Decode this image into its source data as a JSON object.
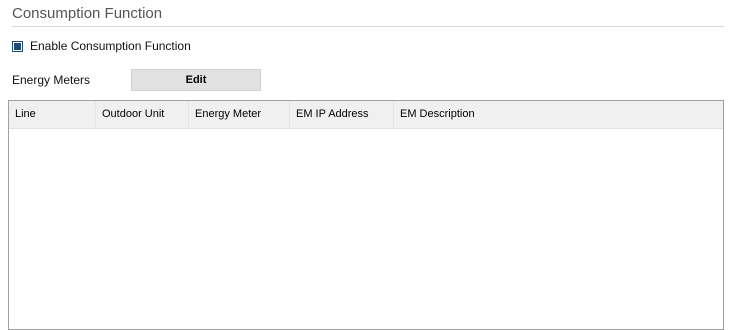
{
  "section": {
    "title": "Consumption Function"
  },
  "enable_checkbox": {
    "label": "Enable Consumption Function",
    "checked": true,
    "color": "#1e4a78"
  },
  "energy_meters": {
    "label": "Energy Meters",
    "edit_label": "Edit"
  },
  "table": {
    "columns": [
      "Line",
      "Outdoor Unit",
      "Energy Meter",
      "EM IP Address",
      "EM Description"
    ],
    "rows": []
  }
}
